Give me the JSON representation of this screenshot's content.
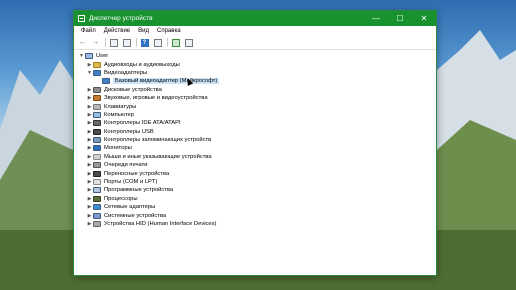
{
  "window": {
    "title": "Диспетчер устройств",
    "controls": {
      "minimize": "—",
      "maximize": "☐",
      "close": "✕"
    }
  },
  "menu": [
    "Файл",
    "Действие",
    "Вид",
    "Справка"
  ],
  "toolbar": {
    "icons": [
      "back-icon",
      "forward-icon",
      "properties-icon",
      "update-icon",
      "help-icon",
      "scan-icon",
      "enable-icon",
      "monitor-icon"
    ]
  },
  "tree": {
    "root": "User",
    "categories": [
      {
        "label": "Аудиовходы и аудиовыходы",
        "icon": "audio-icon"
      },
      {
        "label": "Видеоадаптеры",
        "icon": "display-adapter-icon",
        "expanded": true,
        "children": [
          "Базовый видеоадаптер (Майкрософт)"
        ]
      },
      {
        "label": "Дисковые устройства",
        "icon": "disk-icon"
      },
      {
        "label": "Звуковые, игровые и видеоустройства",
        "icon": "sound-icon"
      },
      {
        "label": "Клавиатуры",
        "icon": "keyboard-icon"
      },
      {
        "label": "Компьютер",
        "icon": "computer-icon"
      },
      {
        "label": "Контроллеры IDE ATA/ATAPI",
        "icon": "ide-icon"
      },
      {
        "label": "Контроллеры USB",
        "icon": "usb-icon"
      },
      {
        "label": "Контроллеры запоминающих устройств",
        "icon": "storage-icon"
      },
      {
        "label": "Мониторы",
        "icon": "monitor-icon"
      },
      {
        "label": "Мыши и иные указывающие устройства",
        "icon": "mouse-icon"
      },
      {
        "label": "Очереди печати",
        "icon": "print-queue-icon"
      },
      {
        "label": "Переносные устройства",
        "icon": "portable-icon"
      },
      {
        "label": "Порты (COM и LPT)",
        "icon": "ports-icon"
      },
      {
        "label": "Программные устройства",
        "icon": "software-icon"
      },
      {
        "label": "Процессоры",
        "icon": "cpu-icon"
      },
      {
        "label": "Сетевые адаптеры",
        "icon": "network-icon"
      },
      {
        "label": "Системные устройства",
        "icon": "system-icon"
      },
      {
        "label": "Устройства HID (Human Interface Devices)",
        "icon": "hid-icon"
      }
    ]
  },
  "colors": {
    "titlebar": "#17922f",
    "selection": "#cce4f7"
  }
}
